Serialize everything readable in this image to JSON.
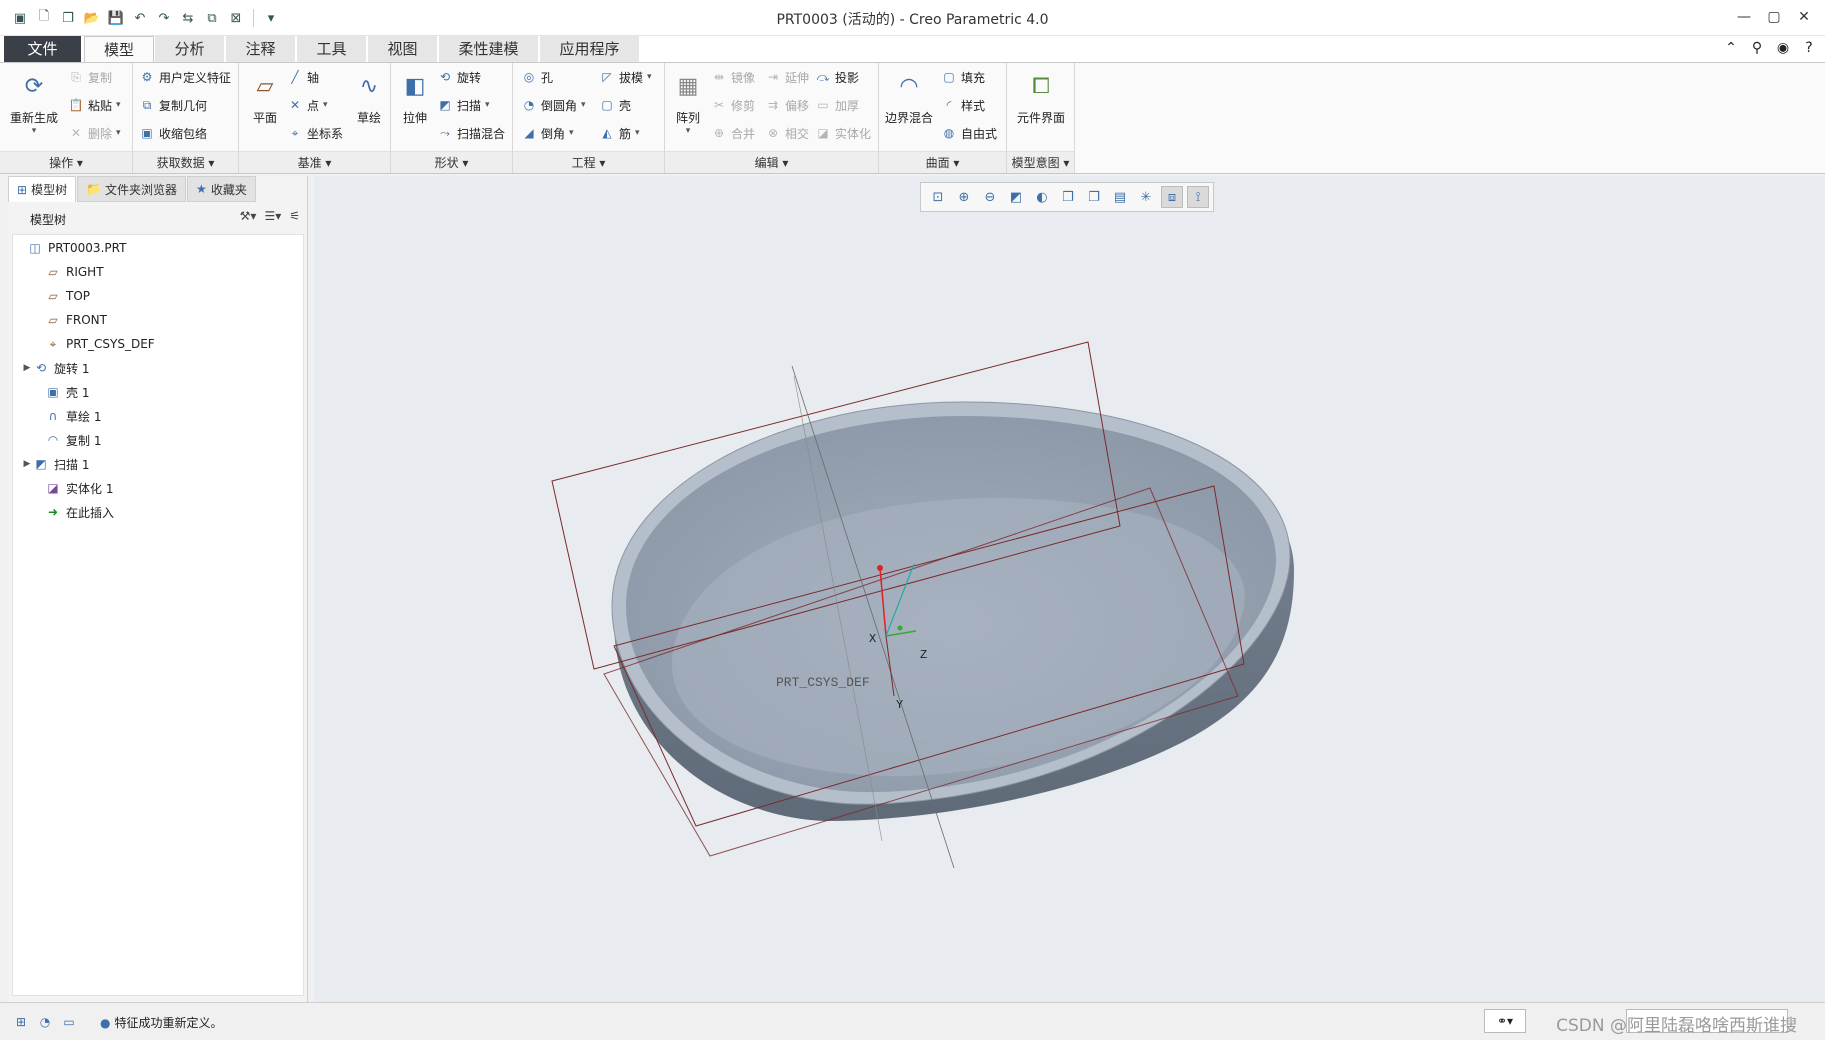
{
  "window": {
    "title": "PRT0003 (活动的) - Creo Parametric 4.0",
    "controls": [
      "—",
      "▢",
      "✕"
    ]
  },
  "tabs": [
    {
      "label": "文件"
    },
    {
      "label": "模型"
    },
    {
      "label": "分析"
    },
    {
      "label": "注释"
    },
    {
      "label": "工具"
    },
    {
      "label": "视图"
    },
    {
      "label": "柔性建模"
    },
    {
      "label": "应用程序"
    }
  ],
  "ribbon": {
    "operations": {
      "label": "操作",
      "regenerate": "重新生成",
      "copy": "复制",
      "paste": "粘贴",
      "delete": "删除"
    },
    "get_data": {
      "label": "获取数据",
      "udf": "用户定义特征",
      "copy_geom": "复制几何",
      "shrinkwrap": "收缩包络"
    },
    "datum": {
      "label": "基准",
      "plane": "平面",
      "axis": "轴",
      "point": "点",
      "csys": "坐标系",
      "sketch": "草绘"
    },
    "shapes": {
      "label": "形状",
      "extrude": "拉伸",
      "revolve": "旋转",
      "sweep": "扫描",
      "swept_blend": "扫描混合"
    },
    "engineering": {
      "label": "工程",
      "hole": "孔",
      "round": "倒圆角",
      "chamfer": "倒角",
      "draft": "拔模",
      "shell": "壳",
      "rib": "筋"
    },
    "editing": {
      "label": "编辑",
      "pattern": "阵列",
      "mirror": "镜像",
      "trim": "修剪",
      "merge": "合并",
      "extend": "延伸",
      "offset": "偏移",
      "intersect": "相交",
      "project": "投影",
      "thicken": "加厚",
      "solidify": "实体化"
    },
    "surfaces": {
      "label": "曲面",
      "boundary_blend": "边界混合",
      "fill": "填充",
      "style": "样式",
      "freestyle": "自由式"
    },
    "model_intent": {
      "label": "模型意图",
      "component_interface": "元件界面"
    }
  },
  "panel": {
    "tabs": [
      {
        "label": "模型树"
      },
      {
        "label": "文件夹浏览器"
      },
      {
        "label": "收藏夹"
      }
    ],
    "header": "模型树",
    "tree": [
      {
        "label": "PRT0003.PRT",
        "icon": "part-icon"
      },
      {
        "label": "RIGHT",
        "icon": "datum-plane-icon"
      },
      {
        "label": "TOP",
        "icon": "datum-plane-icon"
      },
      {
        "label": "FRONT",
        "icon": "datum-plane-icon"
      },
      {
        "label": "PRT_CSYS_DEF",
        "icon": "csys-icon"
      },
      {
        "label": "旋转 1",
        "icon": "revolve-icon"
      },
      {
        "label": "壳 1",
        "icon": "shell-icon"
      },
      {
        "label": "草绘 1",
        "icon": "sketch-icon"
      },
      {
        "label": "复制 1",
        "icon": "copy-icon"
      },
      {
        "label": "扫描 1",
        "icon": "sweep-icon"
      },
      {
        "label": "实体化 1",
        "icon": "solidify-icon"
      },
      {
        "label": "在此插入",
        "icon": "insert-arrow-icon"
      }
    ]
  },
  "viewport": {
    "csys_label": "PRT_CSYS_DEF",
    "axis_x": "X",
    "axis_y": "Y",
    "axis_z": "Z"
  },
  "status": {
    "message": "特征成功重新定义。",
    "watermark": "CSDN @阿里陆磊咯啥西斯谁搜"
  },
  "colors": {
    "file_tab": "#3a3f48",
    "datum_plane": "#7a2a2a",
    "model_surface": "#8e9aaa",
    "viewport_bg": "#e8ebef"
  }
}
